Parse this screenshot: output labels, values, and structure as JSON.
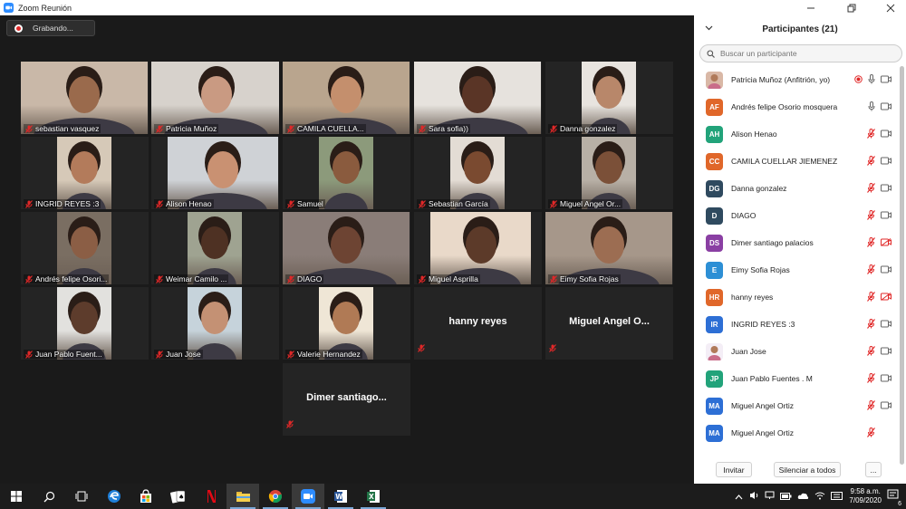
{
  "window": {
    "title": "Zoom Reunión"
  },
  "recording": {
    "label": "Grabando..."
  },
  "tiles": [
    {
      "name": "sebastian vasquez",
      "video": true,
      "bg": "#c9b8a8",
      "skin": "#9a6a4c"
    },
    {
      "name": "Patricia Muñoz",
      "video": true,
      "bg": "#d7d2cc",
      "skin": "#c99a82",
      "active": true
    },
    {
      "name": "CAMILA CUELLA...",
      "video": true,
      "bg": "#b9a58e",
      "skin": "#c48f6d"
    },
    {
      "name": "Sara sofia))",
      "video": true,
      "bg": "#e6e2dd",
      "skin": "#5a3526"
    },
    {
      "name": "Danna gonzalez",
      "video": true,
      "bg": "#e8e4df",
      "skin": "#b8876a"
    },
    {
      "name": "INGRID REYES :3",
      "video": true,
      "bg": "#d6c9b8",
      "skin": "#b37b5b"
    },
    {
      "name": "Alison Henao",
      "video": true,
      "bg": "#cfd2d6",
      "skin": "#c99172"
    },
    {
      "name": "Samuel",
      "video": true,
      "bg": "#8c9a7b",
      "skin": "#8a5b3e"
    },
    {
      "name": "Sebastian García",
      "video": true,
      "bg": "#e3dcd4",
      "skin": "#7a4a30"
    },
    {
      "name": "Miguel Angel Or...",
      "video": true,
      "bg": "#b8b0a6",
      "skin": "#7b5038"
    },
    {
      "name": "Andrés felipe Osori...",
      "video": true,
      "bg": "#7a6e62",
      "skin": "#8b5e45"
    },
    {
      "name": "Weimar Camilo ...",
      "video": true,
      "bg": "#9fa391",
      "skin": "#4e3123"
    },
    {
      "name": "DIAGO",
      "video": true,
      "bg": "#8a7d78",
      "skin": "#6d4433"
    },
    {
      "name": "Miguel Asprilla",
      "video": true,
      "bg": "#e9d9c9",
      "skin": "#5c3a29"
    },
    {
      "name": "Eimy Sofia Rojas",
      "video": true,
      "bg": "#a6978a",
      "skin": "#9c6d52"
    },
    {
      "name": "Juan Pablo Fuent...",
      "video": true,
      "bg": "#e2e1de",
      "skin": "#5d3c2c"
    },
    {
      "name": "Juan Jose",
      "video": true,
      "bg": "#c6d3db",
      "skin": "#c49174"
    },
    {
      "name": "Valerie Hernandez",
      "video": true,
      "bg": "#efe6d6",
      "skin": "#b07a55"
    },
    {
      "name": "hanny reyes",
      "video": false
    },
    {
      "name": "Miguel  Angel  O...",
      "video": false
    },
    {
      "name": "Dimer  santiago...",
      "video": false
    }
  ],
  "panel": {
    "title": "Participantes (21)",
    "search_placeholder": "Buscar un participante",
    "participants": [
      {
        "initials": "",
        "name": "Patricia Muñoz (Anfitrión, yo)",
        "color": "#d9b8a6",
        "photo": true,
        "rec": true,
        "mic": "on",
        "cam": "on"
      },
      {
        "initials": "AF",
        "name": "Andrés felipe Osorio mosquera",
        "color": "#e0672a",
        "mic": "on",
        "cam": "on"
      },
      {
        "initials": "AH",
        "name": "Alison Henao",
        "color": "#22a37a",
        "mic": "muted",
        "cam": "on"
      },
      {
        "initials": "CC",
        "name": "CAMILA CUELLAR JIEMENEZ",
        "color": "#e0672a",
        "mic": "muted",
        "cam": "on"
      },
      {
        "initials": "DG",
        "name": "Danna gonzalez",
        "color": "#2f4a5f",
        "mic": "muted",
        "cam": "on"
      },
      {
        "initials": "D",
        "name": "DIAGO",
        "color": "#2f4a5f",
        "mic": "muted",
        "cam": "on"
      },
      {
        "initials": "DS",
        "name": "Dimer santiago palacios",
        "color": "#8a3fa3",
        "mic": "muted",
        "cam": "off"
      },
      {
        "initials": "E",
        "name": "Eimy Sofia Rojas",
        "color": "#2d8fd5",
        "mic": "muted",
        "cam": "on"
      },
      {
        "initials": "HR",
        "name": "hanny reyes",
        "color": "#e0672a",
        "mic": "muted",
        "cam": "off"
      },
      {
        "initials": "IR",
        "name": "INGRID REYES :3",
        "color": "#2d6fd5",
        "mic": "muted",
        "cam": "on"
      },
      {
        "initials": "",
        "name": "Juan Jose",
        "color": "#f4eef6",
        "photo": true,
        "mic": "muted",
        "cam": "on"
      },
      {
        "initials": "JP",
        "name": "Juan Pablo Fuentes . M",
        "color": "#22a37a",
        "mic": "muted",
        "cam": "on"
      },
      {
        "initials": "MA",
        "name": "Miguel Angel Ortiz",
        "color": "#2d6fd5",
        "mic": "muted",
        "cam": "on"
      },
      {
        "initials": "MA",
        "name": "Miguel Angel Ortiz",
        "color": "#2d6fd5",
        "mic": "muted",
        "cam": "none"
      }
    ],
    "footer": {
      "invite": "Invitar",
      "mute_all": "Silenciar a todos",
      "more": "..."
    }
  },
  "taskbar": {
    "time": "9:58 a.m.",
    "date": "7/09/2020",
    "notifications": "6"
  }
}
